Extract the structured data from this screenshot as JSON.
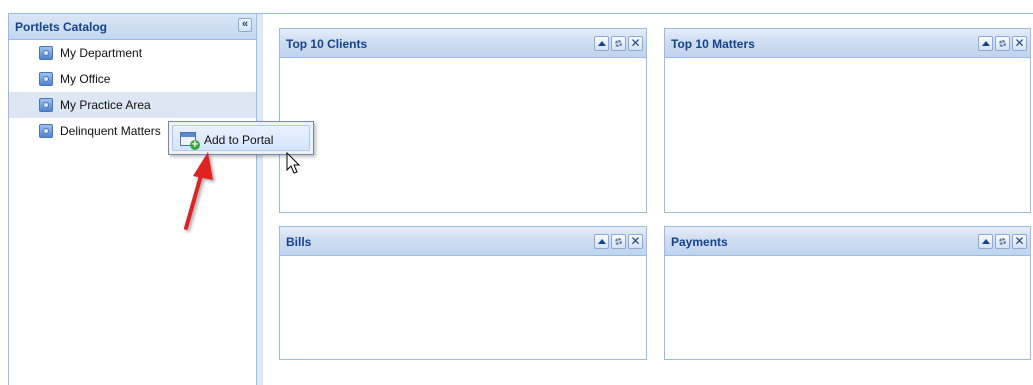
{
  "sidebar": {
    "title": "Portlets Catalog",
    "collapse_symbol": "«",
    "items": [
      {
        "label": "My Department",
        "icon": "portlet-icon"
      },
      {
        "label": "My Office",
        "icon": "portlet-icon"
      },
      {
        "label": "My Practice Area",
        "icon": "portlet-icon",
        "selected": true
      },
      {
        "label": "Delinquent Matters",
        "icon": "portlet-icon"
      }
    ]
  },
  "context_menu": {
    "items": [
      {
        "label": "Add to Portal",
        "icon": "add-portlet-icon"
      }
    ]
  },
  "portlets": [
    {
      "title": "Top 10 Clients",
      "tools": [
        "collapse-icon",
        "gear-icon",
        "close-icon"
      ]
    },
    {
      "title": "Top 10 Matters",
      "tools": [
        "collapse-icon",
        "gear-icon",
        "close-icon"
      ]
    },
    {
      "title": "Bills",
      "tools": [
        "collapse-icon",
        "gear-icon",
        "close-icon"
      ]
    },
    {
      "title": "Payments",
      "tools": [
        "collapse-icon",
        "gear-icon",
        "close-icon"
      ]
    }
  ],
  "colors": {
    "header_text": "#15428b",
    "border": "#99bbe8",
    "annotation_arrow": "#e02020"
  }
}
